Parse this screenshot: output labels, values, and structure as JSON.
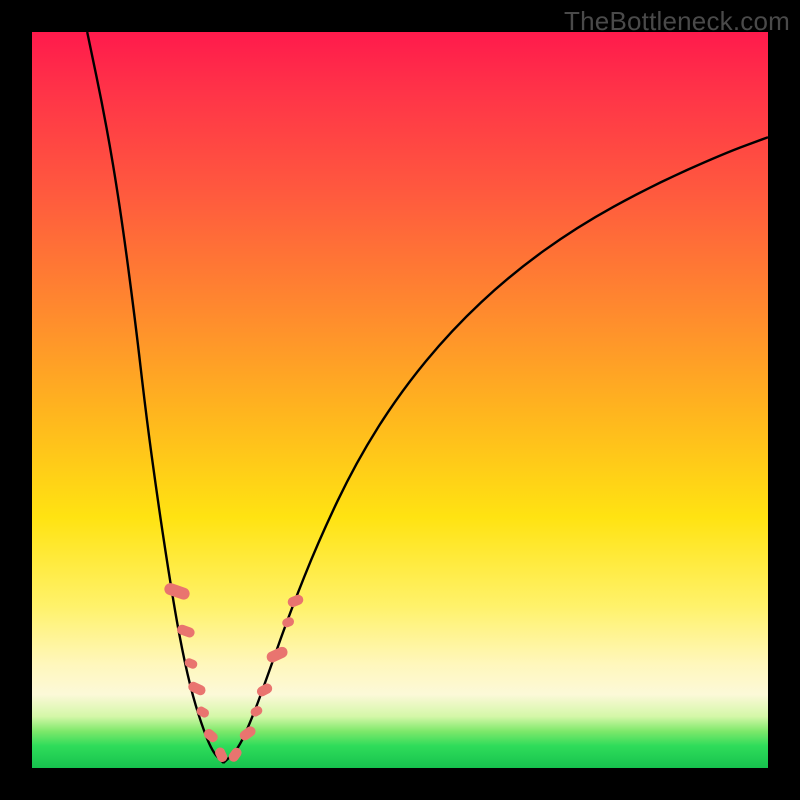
{
  "watermark": "TheBottleneck.com",
  "colors": {
    "curve_stroke": "#000000",
    "marker_fill": "#e9746f",
    "marker_stroke": "#d85f5a",
    "frame": "#000000"
  },
  "chart_data": {
    "type": "line",
    "title": "",
    "xlabel": "",
    "ylabel": "",
    "xlim_percent": [
      0,
      100
    ],
    "ylim_percent": [
      0,
      100
    ],
    "note": "No axis ticks or numeric labels are visible; values below are positions as % of plot area (0,0 = top-left) estimated from pixels.",
    "series": [
      {
        "name": "left-branch",
        "kind": "curve",
        "points_pct": [
          [
            7.5,
            0
          ],
          [
            10,
            12
          ],
          [
            12,
            24
          ],
          [
            14,
            39
          ],
          [
            15.5,
            52
          ],
          [
            17,
            63
          ],
          [
            18.5,
            73
          ],
          [
            20,
            82
          ],
          [
            21.5,
            89
          ],
          [
            23,
            94
          ],
          [
            24.5,
            97.8
          ],
          [
            26,
            99.3
          ]
        ]
      },
      {
        "name": "right-branch",
        "kind": "curve",
        "points_pct": [
          [
            26,
            99.3
          ],
          [
            28,
            97.5
          ],
          [
            30,
            93
          ],
          [
            32,
            87.5
          ],
          [
            35,
            79
          ],
          [
            39,
            69
          ],
          [
            44,
            58.5
          ],
          [
            50,
            49
          ],
          [
            57,
            40.5
          ],
          [
            65,
            33
          ],
          [
            74,
            26.5
          ],
          [
            84,
            21
          ],
          [
            94,
            16.5
          ],
          [
            100,
            14.3
          ]
        ]
      }
    ],
    "markers": {
      "name": "highlighted-points",
      "shape": "rounded-capsule",
      "points_pct": [
        [
          19.7,
          76.0,
          12,
          26,
          -71
        ],
        [
          20.9,
          81.4,
          10,
          18,
          -70
        ],
        [
          21.6,
          85.8,
          9,
          13,
          -68
        ],
        [
          22.4,
          89.2,
          10,
          18,
          -65
        ],
        [
          23.2,
          92.4,
          9,
          13,
          -60
        ],
        [
          24.3,
          95.6,
          10,
          15,
          -50
        ],
        [
          25.7,
          98.2,
          10,
          15,
          -25
        ],
        [
          27.6,
          98.2,
          10,
          15,
          35
        ],
        [
          29.3,
          95.3,
          10,
          17,
          55
        ],
        [
          30.5,
          92.3,
          9,
          12,
          60
        ],
        [
          31.6,
          89.4,
          10,
          16,
          62
        ],
        [
          33.3,
          84.6,
          11,
          22,
          65
        ],
        [
          34.8,
          80.2,
          9,
          12,
          67
        ],
        [
          35.8,
          77.3,
          10,
          16,
          68
        ]
      ],
      "fields": "x%, y%, width_px, height_px, rotation_deg"
    }
  }
}
